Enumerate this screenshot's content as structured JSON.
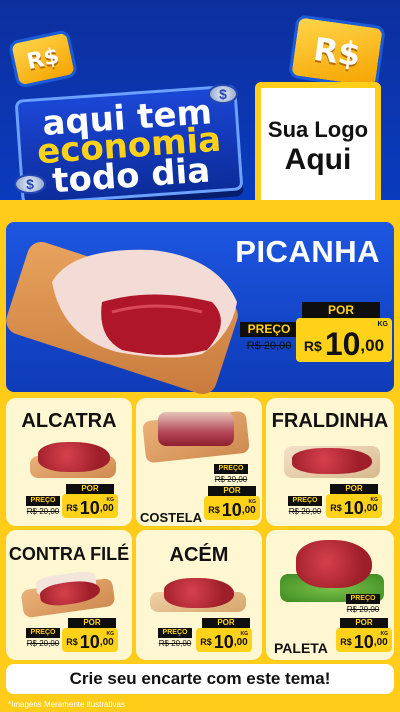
{
  "header": {
    "coin_symbol": "R$",
    "banner_lines": [
      "aqui tem",
      "economia",
      "todo dia"
    ],
    "logo_lines": [
      "Sua Logo",
      "Aqui"
    ]
  },
  "hero": {
    "name": "PICANHA",
    "preco_label": "PREÇO",
    "old_price": "R$ 20,00",
    "por_label": "POR",
    "currency": "R$",
    "price_int": "10",
    "price_dec": ",00",
    "unit": "KG"
  },
  "cards": [
    {
      "name": "ALCATRA",
      "preco_label": "PREÇO",
      "old_price": "R$ 20,00",
      "por_label": "POR",
      "currency": "R$",
      "price_int": "10",
      "price_dec": ",00",
      "unit": "KG"
    },
    {
      "name": "COSTELA",
      "preco_label": "PREÇO",
      "old_price": "R$ 20,00",
      "por_label": "POR",
      "currency": "R$",
      "price_int": "10",
      "price_dec": ",00",
      "unit": "KG"
    },
    {
      "name": "FRALDINHA",
      "preco_label": "PREÇO",
      "old_price": "R$ 20,00",
      "por_label": "POR",
      "currency": "R$",
      "price_int": "10",
      "price_dec": ",00",
      "unit": "KG"
    },
    {
      "name": "CONTRA FILÉ",
      "preco_label": "PREÇO",
      "old_price": "R$ 20,00",
      "por_label": "POR",
      "currency": "R$",
      "price_int": "10",
      "price_dec": ",00",
      "unit": "KG"
    },
    {
      "name": "ACÉM",
      "preco_label": "PREÇO",
      "old_price": "R$ 20,00",
      "por_label": "POR",
      "currency": "R$",
      "price_int": "10",
      "price_dec": ",00",
      "unit": "KG"
    },
    {
      "name": "PALETA",
      "preco_label": "PREÇO",
      "old_price": "R$ 20,00",
      "por_label": "POR",
      "currency": "R$",
      "price_int": "10",
      "price_dec": ",00",
      "unit": "KG"
    }
  ],
  "cta": "Crie seu encarte com este tema!",
  "footnote": "*Imagens Meramente Ilustrativas",
  "colors": {
    "blue": "#0e3bb8",
    "yellow": "#ffcc1a",
    "price_yellow": "#ffd21a",
    "black": "#0e0e0e",
    "card": "#fff6d2"
  }
}
